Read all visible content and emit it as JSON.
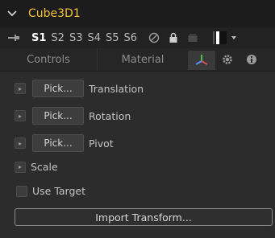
{
  "tool": {
    "name": "Cube3D1"
  },
  "versions": {
    "active": "S1",
    "items": [
      "S2",
      "S3",
      "S4",
      "S5",
      "S6"
    ]
  },
  "tabs": {
    "controls": "Controls",
    "material": "Material"
  },
  "icons": {
    "collapse": "chevron-down-icon",
    "pin": "pin-icon",
    "disable": "disable-icon",
    "lock": "lock-icon",
    "locked_version": "locked-version-icon",
    "color": "color-swatch-icon",
    "transform": "transform-axes-icon",
    "settings": "gear-icon",
    "info": "info-icon"
  },
  "transform": {
    "pick_label": "Pick...",
    "translation": "Translation",
    "rotation": "Rotation",
    "pivot": "Pivot",
    "scale": "Scale",
    "use_target": "Use Target",
    "import_transform": "Import Transform..."
  },
  "colors": {
    "title": "#f1c232",
    "axis_x": "#e05050",
    "axis_y": "#4fc04f",
    "axis_z": "#5b8ff0"
  }
}
